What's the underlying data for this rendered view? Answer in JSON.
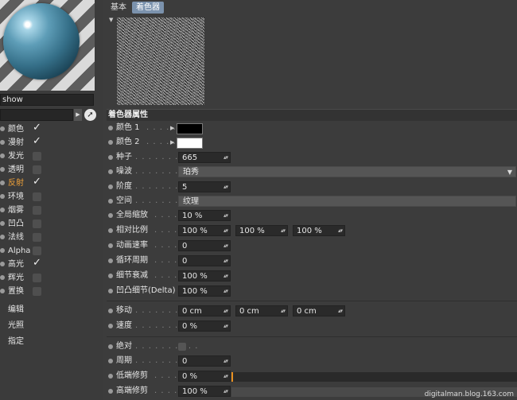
{
  "material": {
    "name": "show"
  },
  "channels": [
    {
      "label": "颜色",
      "checked": true,
      "active": false
    },
    {
      "label": "漫射",
      "checked": true,
      "active": false
    },
    {
      "label": "发光",
      "checked": false,
      "active": false
    },
    {
      "label": "透明",
      "checked": false,
      "active": false
    },
    {
      "label": "反射",
      "checked": true,
      "active": true
    },
    {
      "label": "环境",
      "checked": false,
      "active": false
    },
    {
      "label": "烟雾",
      "checked": false,
      "active": false
    },
    {
      "label": "凹凸",
      "checked": false,
      "active": false
    },
    {
      "label": "法线",
      "checked": false,
      "active": false
    },
    {
      "label": "Alpha",
      "checked": false,
      "active": false
    },
    {
      "label": "高光",
      "checked": true,
      "active": false
    },
    {
      "label": "辉光",
      "checked": false,
      "active": false
    },
    {
      "label": "置换",
      "checked": false,
      "active": false
    }
  ],
  "extra_items": [
    "编辑",
    "光照",
    "指定"
  ],
  "tabs": [
    "基本",
    "着色器"
  ],
  "active_tab": "着色器",
  "section_title": "着色器属性",
  "params": {
    "color1": {
      "label": "颜色 1",
      "value": "#000000"
    },
    "color2": {
      "label": "颜色 2",
      "value": "#ffffff"
    },
    "seed": {
      "label": "种子",
      "value": "665"
    },
    "noise": {
      "label": "噪波",
      "value": "珀秀"
    },
    "octaves": {
      "label": "阶度",
      "value": "5"
    },
    "space": {
      "label": "空间",
      "value": "纹理"
    },
    "global_scale": {
      "label": "全局缩放",
      "value": "10 %"
    },
    "relative_scale": {
      "label": "相对比例",
      "values": [
        "100 %",
        "100 %",
        "100 %"
      ]
    },
    "anim_speed": {
      "label": "动画速率",
      "value": "0"
    },
    "loop_period": {
      "label": "循环周期",
      "value": "0"
    },
    "detail_atten": {
      "label": "细节衰减",
      "value": "100 %"
    },
    "delta": {
      "label": "凹凸细节(Delta)",
      "value": "100 %"
    },
    "move": {
      "label": "移动",
      "values": [
        "0 cm",
        "0 cm",
        "0 cm"
      ]
    },
    "speed": {
      "label": "速度",
      "value": "0 %"
    },
    "absolute": {
      "label": "绝对",
      "checked": false
    },
    "period": {
      "label": "周期",
      "value": "0"
    },
    "low_clip": {
      "label": "低端修剪",
      "value": "0 %"
    },
    "high_clip": {
      "label": "高端修剪",
      "value": "100 %"
    }
  },
  "watermark": "digitalman.blog.163.com"
}
